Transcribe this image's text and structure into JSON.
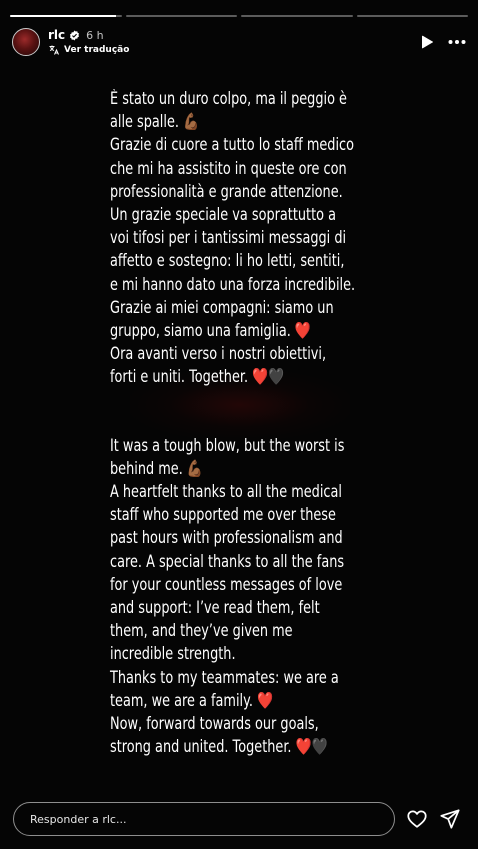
{
  "progress": {
    "segments": 4,
    "active_index": 0,
    "active_fill": 0.95
  },
  "header": {
    "username": "rlc",
    "time": "6 h",
    "translate_label": "Ver tradução",
    "verified": true
  },
  "story_text": {
    "italian": [
      "È stato un duro colpo, ma il peggio è",
      "alle spalle. 💪🏾",
      "Grazie di cuore a tutto lo staff medico",
      "che mi ha assistito in queste ore con",
      "professionalità e grande attenzione.",
      "Un grazie speciale va soprattutto a",
      "voi tifosi per i tantissimi messaggi di",
      "affetto e sostegno: li ho letti, sentiti,",
      "e mi hanno dato una forza incredibile.",
      "Grazie ai miei compagni: siamo un",
      "gruppo, siamo una famiglia. ❤️",
      "Ora avanti verso i nostri obiettivi,",
      "forti e uniti. Together. ❤️🖤"
    ],
    "english": [
      "It was a tough blow, but the worst is",
      "behind me. 💪🏾",
      "A heartfelt thanks to all the medical",
      "staff who supported me over these",
      "past hours with professionalism and",
      "care. A special thanks to all the fans",
      "for your countless messages of love",
      "and support: I’ve read them, felt",
      "them, and they’ve given me",
      "incredible strength.",
      "Thanks to my teammates: we are a",
      "team, we are a family. ❤️",
      "Now, forward towards our goals,",
      "strong and united. Together. ❤️🖤"
    ]
  },
  "reply": {
    "placeholder": "Responder a rlc..."
  },
  "icons": {
    "play": "play-icon",
    "more": "more-icon",
    "like": "heart-icon",
    "share": "send-icon",
    "translate": "translate-icon",
    "verified": "verified-badge-icon"
  },
  "colors": {
    "background": "#000000",
    "text": "#ffffff",
    "verified": "#ffffff"
  }
}
